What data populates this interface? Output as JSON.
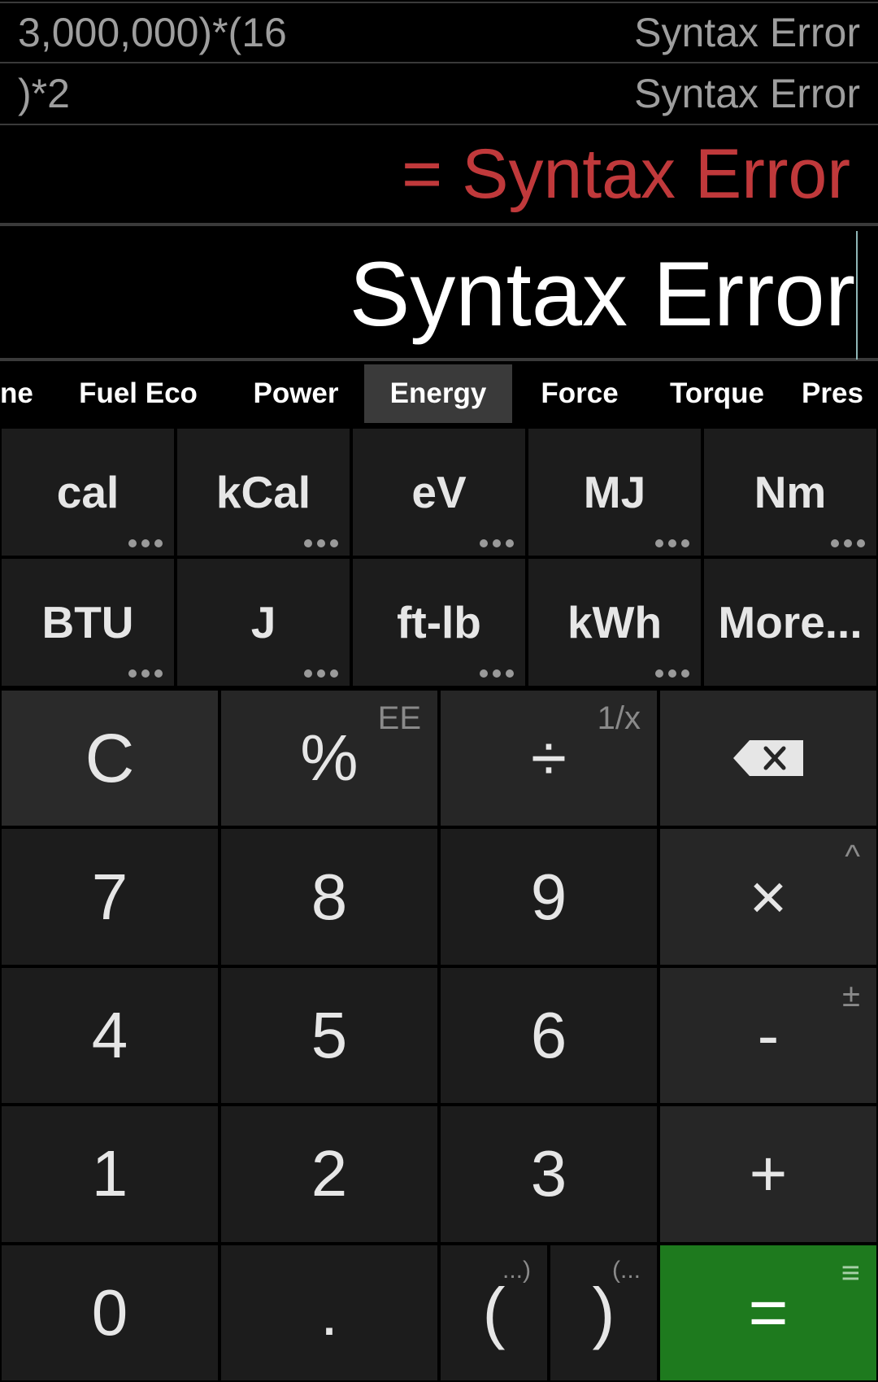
{
  "history": [
    {
      "expression": "3,000,000)*(16",
      "result": "Syntax Error"
    },
    {
      "expression": ")*2",
      "result": "Syntax Error"
    }
  ],
  "result_line": "= Syntax Error",
  "display": "Syntax Error",
  "tabs": [
    {
      "label": "ne",
      "active": false
    },
    {
      "label": "Fuel Eco",
      "active": false
    },
    {
      "label": "Power",
      "active": false
    },
    {
      "label": "Energy",
      "active": true
    },
    {
      "label": "Force",
      "active": false
    },
    {
      "label": "Torque",
      "active": false
    },
    {
      "label": "Pres",
      "active": false
    }
  ],
  "units": [
    "cal",
    "kCal",
    "eV",
    "MJ",
    "Nm",
    "BTU",
    "J",
    "ft-lb",
    "kWh",
    "More..."
  ],
  "keys": {
    "clear": "C",
    "percent": "%",
    "percent_secondary": "EE",
    "divide": "÷",
    "divide_secondary": "1/x",
    "seven": "7",
    "eight": "8",
    "nine": "9",
    "multiply": "×",
    "multiply_secondary": "^",
    "four": "4",
    "five": "5",
    "six": "6",
    "minus": "-",
    "minus_secondary": "±",
    "one": "1",
    "two": "2",
    "three": "3",
    "plus": "+",
    "zero": "0",
    "dot": ".",
    "open_paren": "(",
    "open_paren_secondary": "...)",
    "close_paren": ")",
    "close_paren_secondary": "(...",
    "equals": "=",
    "equals_secondary": "≡"
  },
  "colors": {
    "result": "#c0393b",
    "equals_key": "#1e7a1e"
  }
}
